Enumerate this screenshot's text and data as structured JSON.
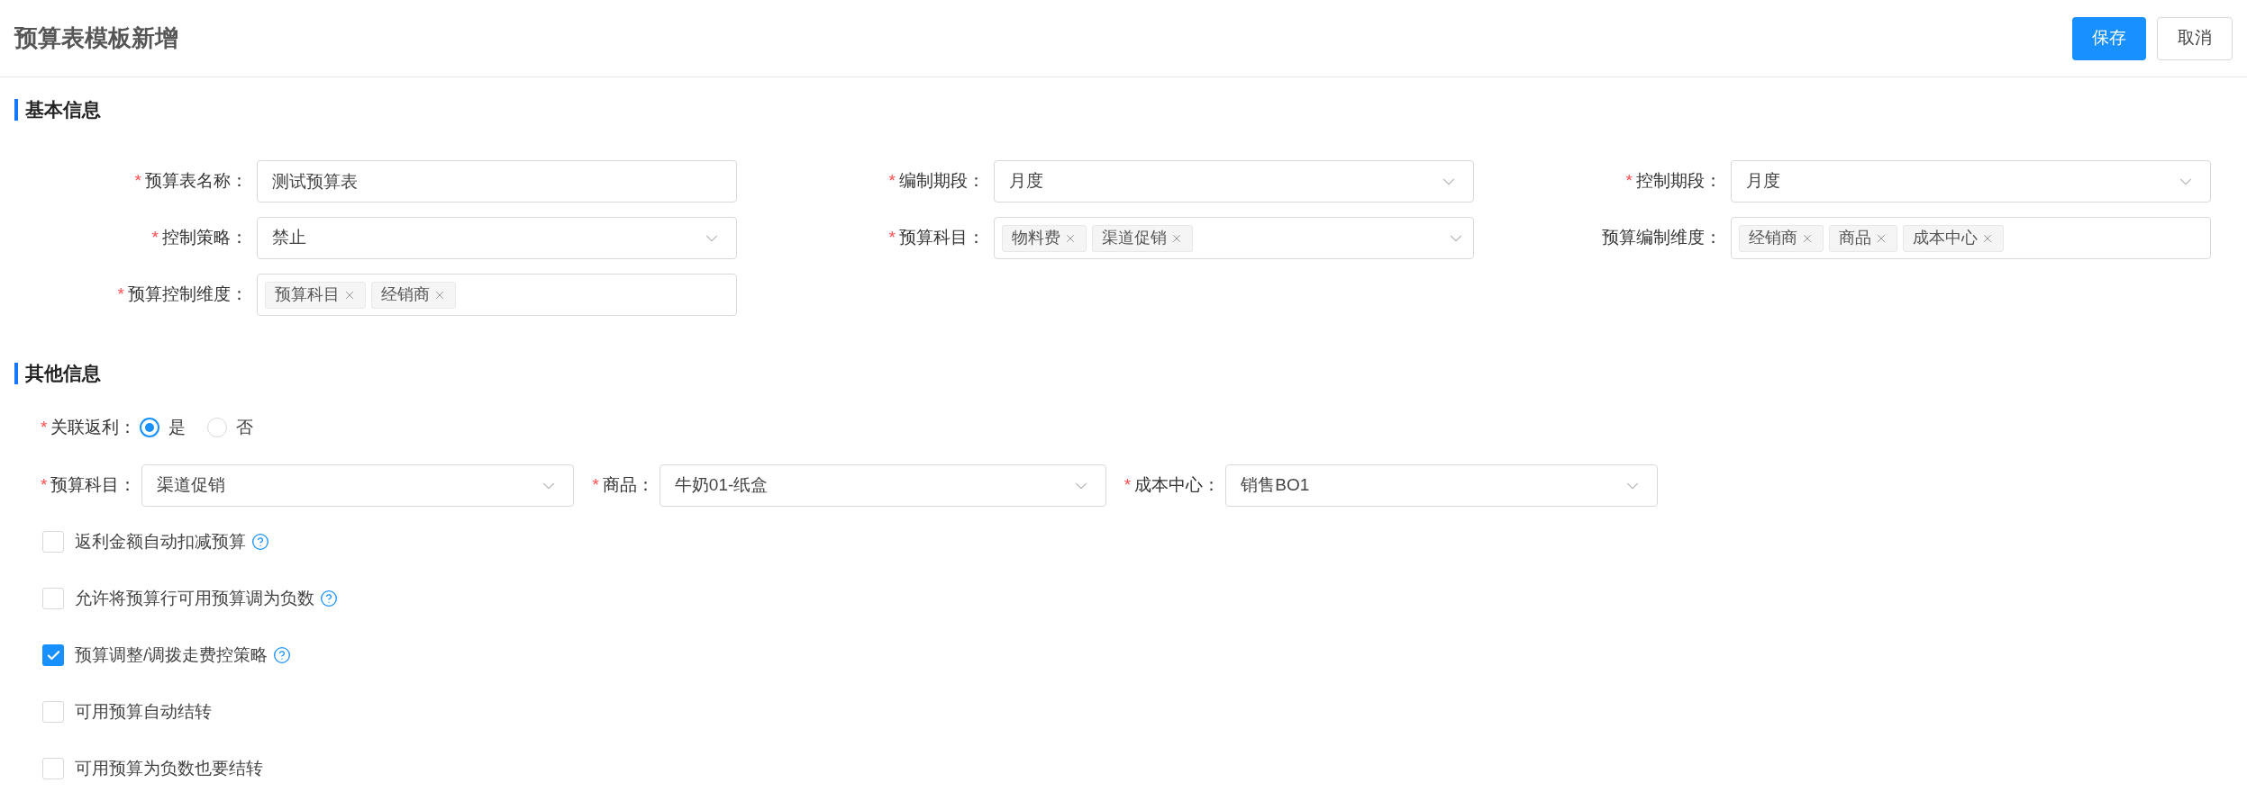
{
  "header": {
    "title": "预算表模板新增",
    "buttons": [
      {
        "label": "保存",
        "kind": "primary"
      },
      {
        "label": "取消",
        "kind": "default"
      }
    ]
  },
  "basic_info": {
    "title": "基本信息",
    "fields": [
      {
        "label": "预算表名称：",
        "required_mark": "*",
        "kind": "input",
        "value": "测试预算表"
      },
      {
        "label": "编制期段：",
        "required_mark": "*",
        "kind": "select",
        "value": "月度"
      },
      {
        "label": "控制期段：",
        "required_mark": "*",
        "kind": "select",
        "value": "月度"
      },
      {
        "label": "控制策略：",
        "required_mark": "*",
        "kind": "select",
        "value": "禁止"
      },
      {
        "label": "预算科目：",
        "required_mark": "*",
        "kind": "tag-select",
        "tags": [
          "物料费",
          "渠道促销"
        ]
      },
      {
        "label": "预算编制维度：",
        "kind": "tags",
        "tags": [
          "经销商",
          "商品",
          "成本中心"
        ]
      },
      {
        "label": "预算控制维度：",
        "required_mark": "*",
        "kind": "tags",
        "tags": [
          "预算科目",
          "经销商"
        ]
      }
    ]
  },
  "other_info": {
    "title": "其他信息",
    "rebate": {
      "label": "关联返利：",
      "required_mark": "*",
      "options": [
        {
          "label": "是",
          "selected": true
        },
        {
          "label": "否",
          "selected": false
        }
      ]
    },
    "selects": [
      {
        "label": "预算科目：",
        "required_mark": "*",
        "value": "渠道促销"
      },
      {
        "label": "商品：",
        "required_mark": "*",
        "value": "牛奶01-纸盒"
      },
      {
        "label": "成本中心：",
        "required_mark": "*",
        "value": "销售BO1"
      }
    ],
    "checkboxes": [
      {
        "label": "返利金额自动扣减预算",
        "checked": false,
        "help": true
      },
      {
        "label": "允许将预算行可用预算调为负数",
        "checked": false,
        "help": true
      },
      {
        "label": "预算调整/调拨走费控策略",
        "checked": true,
        "help": true
      },
      {
        "label": "可用预算自动结转",
        "checked": false,
        "help": false
      },
      {
        "label": "可用预算为负数也要结转",
        "checked": false,
        "help": false
      }
    ]
  }
}
